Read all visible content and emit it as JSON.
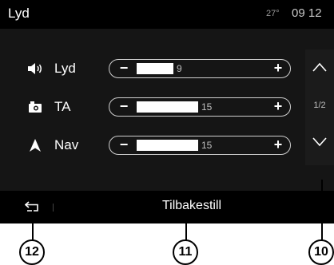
{
  "header": {
    "title": "Lyd",
    "temperature": "27°",
    "time": "09 12"
  },
  "rows": [
    {
      "label": "Lyd",
      "icon": "speaker-icon",
      "value": "9",
      "level": 9,
      "minus": "−",
      "plus": "+"
    },
    {
      "label": "TA",
      "icon": "traffic-announcement-icon",
      "value": "15",
      "level": 15,
      "minus": "−",
      "plus": "+"
    },
    {
      "label": "Nav",
      "icon": "navigation-arrow-icon",
      "value": "15",
      "level": 15,
      "minus": "−",
      "plus": "+"
    }
  ],
  "scroll": {
    "page": "1/2",
    "up_icon": "chevron-up-icon",
    "down_icon": "chevron-down-icon"
  },
  "footer": {
    "back_icon": "back-arrow-icon",
    "reset_label": "Tilbakestill"
  },
  "callouts": [
    "12",
    "11",
    "10"
  ]
}
